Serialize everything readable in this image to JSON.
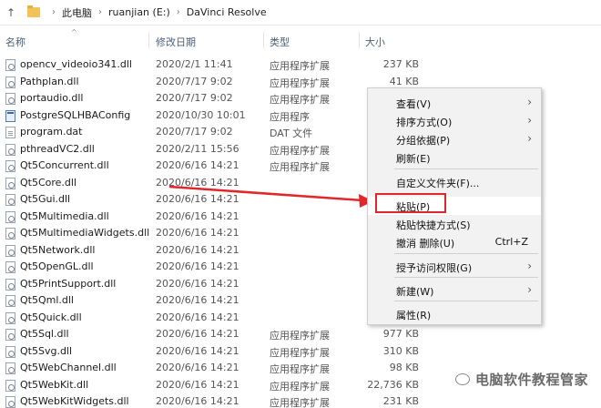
{
  "address": {
    "crumbs": [
      "此电脑",
      "ruanjian (E:)",
      "DaVinci Resolve"
    ],
    "separator": ">"
  },
  "columns": {
    "name": "名称",
    "date": "修改日期",
    "type": "类型",
    "size": "大小"
  },
  "files": [
    {
      "name": "opencv_videoio341.dll",
      "date": "2020/2/1 11:41",
      "type": "应用程序扩展",
      "size": "237 KB",
      "icon": "dll-file-icon"
    },
    {
      "name": "Pathplan.dll",
      "date": "2020/7/17 9:02",
      "type": "应用程序扩展",
      "size": "41 KB",
      "icon": "dll-file-icon"
    },
    {
      "name": "portaudio.dll",
      "date": "2020/7/17 9:02",
      "type": "应用程序扩展",
      "size": "",
      "icon": "dll-file-icon"
    },
    {
      "name": "PostgreSQLHBAConfig",
      "date": "2020/10/30 10:01",
      "type": "应用程序",
      "size": "",
      "icon": "application-icon"
    },
    {
      "name": "program.dat",
      "date": "2020/7/17 9:02",
      "type": "DAT 文件",
      "size": "",
      "icon": "dat-file-icon"
    },
    {
      "name": "pthreadVC2.dll",
      "date": "2020/2/11 15:56",
      "type": "应用程序扩展",
      "size": "",
      "icon": "dll-file-icon"
    },
    {
      "name": "Qt5Concurrent.dll",
      "date": "2020/6/16 14:21",
      "type": "应用程序扩展",
      "size": "",
      "icon": "dll-file-icon"
    },
    {
      "name": "Qt5Core.dll",
      "date": "2020/6/16 14:21",
      "type": "",
      "size": "",
      "icon": "dll-file-icon"
    },
    {
      "name": "Qt5Gui.dll",
      "date": "2020/6/16 14:21",
      "type": "",
      "size": "",
      "icon": "dll-file-icon"
    },
    {
      "name": "Qt5Multimedia.dll",
      "date": "2020/6/16 14:21",
      "type": "",
      "size": "",
      "icon": "dll-file-icon"
    },
    {
      "name": "Qt5MultimediaWidgets.dll",
      "date": "2020/6/16 14:21",
      "type": "",
      "size": "",
      "icon": "dll-file-icon"
    },
    {
      "name": "Qt5Network.dll",
      "date": "2020/6/16 14:21",
      "type": "",
      "size": "",
      "icon": "dll-file-icon"
    },
    {
      "name": "Qt5OpenGL.dll",
      "date": "2020/6/16 14:21",
      "type": "",
      "size": "",
      "icon": "dll-file-icon"
    },
    {
      "name": "Qt5PrintSupport.dll",
      "date": "2020/6/16 14:21",
      "type": "",
      "size": "",
      "icon": "dll-file-icon"
    },
    {
      "name": "Qt5Qml.dll",
      "date": "2020/6/16 14:21",
      "type": "",
      "size": "",
      "icon": "dll-file-icon"
    },
    {
      "name": "Qt5Quick.dll",
      "date": "2020/6/16 14:21",
      "type": "",
      "size": "",
      "icon": "dll-file-icon"
    },
    {
      "name": "Qt5Sql.dll",
      "date": "2020/6/16 14:21",
      "type": "应用程序扩展",
      "size": "977 KB",
      "icon": "dll-file-icon"
    },
    {
      "name": "Qt5Svg.dll",
      "date": "2020/6/16 14:21",
      "type": "应用程序扩展",
      "size": "310 KB",
      "icon": "dll-file-icon"
    },
    {
      "name": "Qt5WebChannel.dll",
      "date": "2020/6/16 14:21",
      "type": "应用程序扩展",
      "size": "98 KB",
      "icon": "dll-file-icon"
    },
    {
      "name": "Qt5WebKit.dll",
      "date": "2020/6/16 14:21",
      "type": "应用程序扩展",
      "size": "22,736 KB",
      "icon": "dll-file-icon"
    },
    {
      "name": "Qt5WebKitWidgets.dll",
      "date": "2020/6/16 14:21",
      "type": "应用程序扩展",
      "size": "231 KB",
      "icon": "dll-file-icon"
    }
  ],
  "context_menu": {
    "items": [
      {
        "label": "查看(V)",
        "shortcut": "",
        "submenu": true
      },
      {
        "label": "排序方式(O)",
        "shortcut": "",
        "submenu": true
      },
      {
        "label": "分组依据(P)",
        "shortcut": "",
        "submenu": true
      },
      {
        "label": "刷新(E)",
        "shortcut": "",
        "submenu": false
      },
      {
        "label": "自定义文件夹(F)...",
        "shortcut": "",
        "submenu": false
      },
      {
        "label": "粘贴(P)",
        "shortcut": "",
        "submenu": false,
        "highlighted": true
      },
      {
        "label": "粘贴快捷方式(S)",
        "shortcut": "",
        "submenu": false
      },
      {
        "label": "撤消 删除(U)",
        "shortcut": "Ctrl+Z",
        "submenu": false
      },
      {
        "label": "授予访问权限(G)",
        "shortcut": "",
        "submenu": true
      },
      {
        "label": "新建(W)",
        "shortcut": "",
        "submenu": true
      },
      {
        "label": "属性(R)",
        "shortcut": "",
        "submenu": false
      }
    ]
  },
  "annotation": {
    "arrow_color": "#e0282c",
    "box_color": "#e0282c"
  },
  "watermark": {
    "text": "电脑软件教程管家",
    "icon": "wechat-icon"
  }
}
